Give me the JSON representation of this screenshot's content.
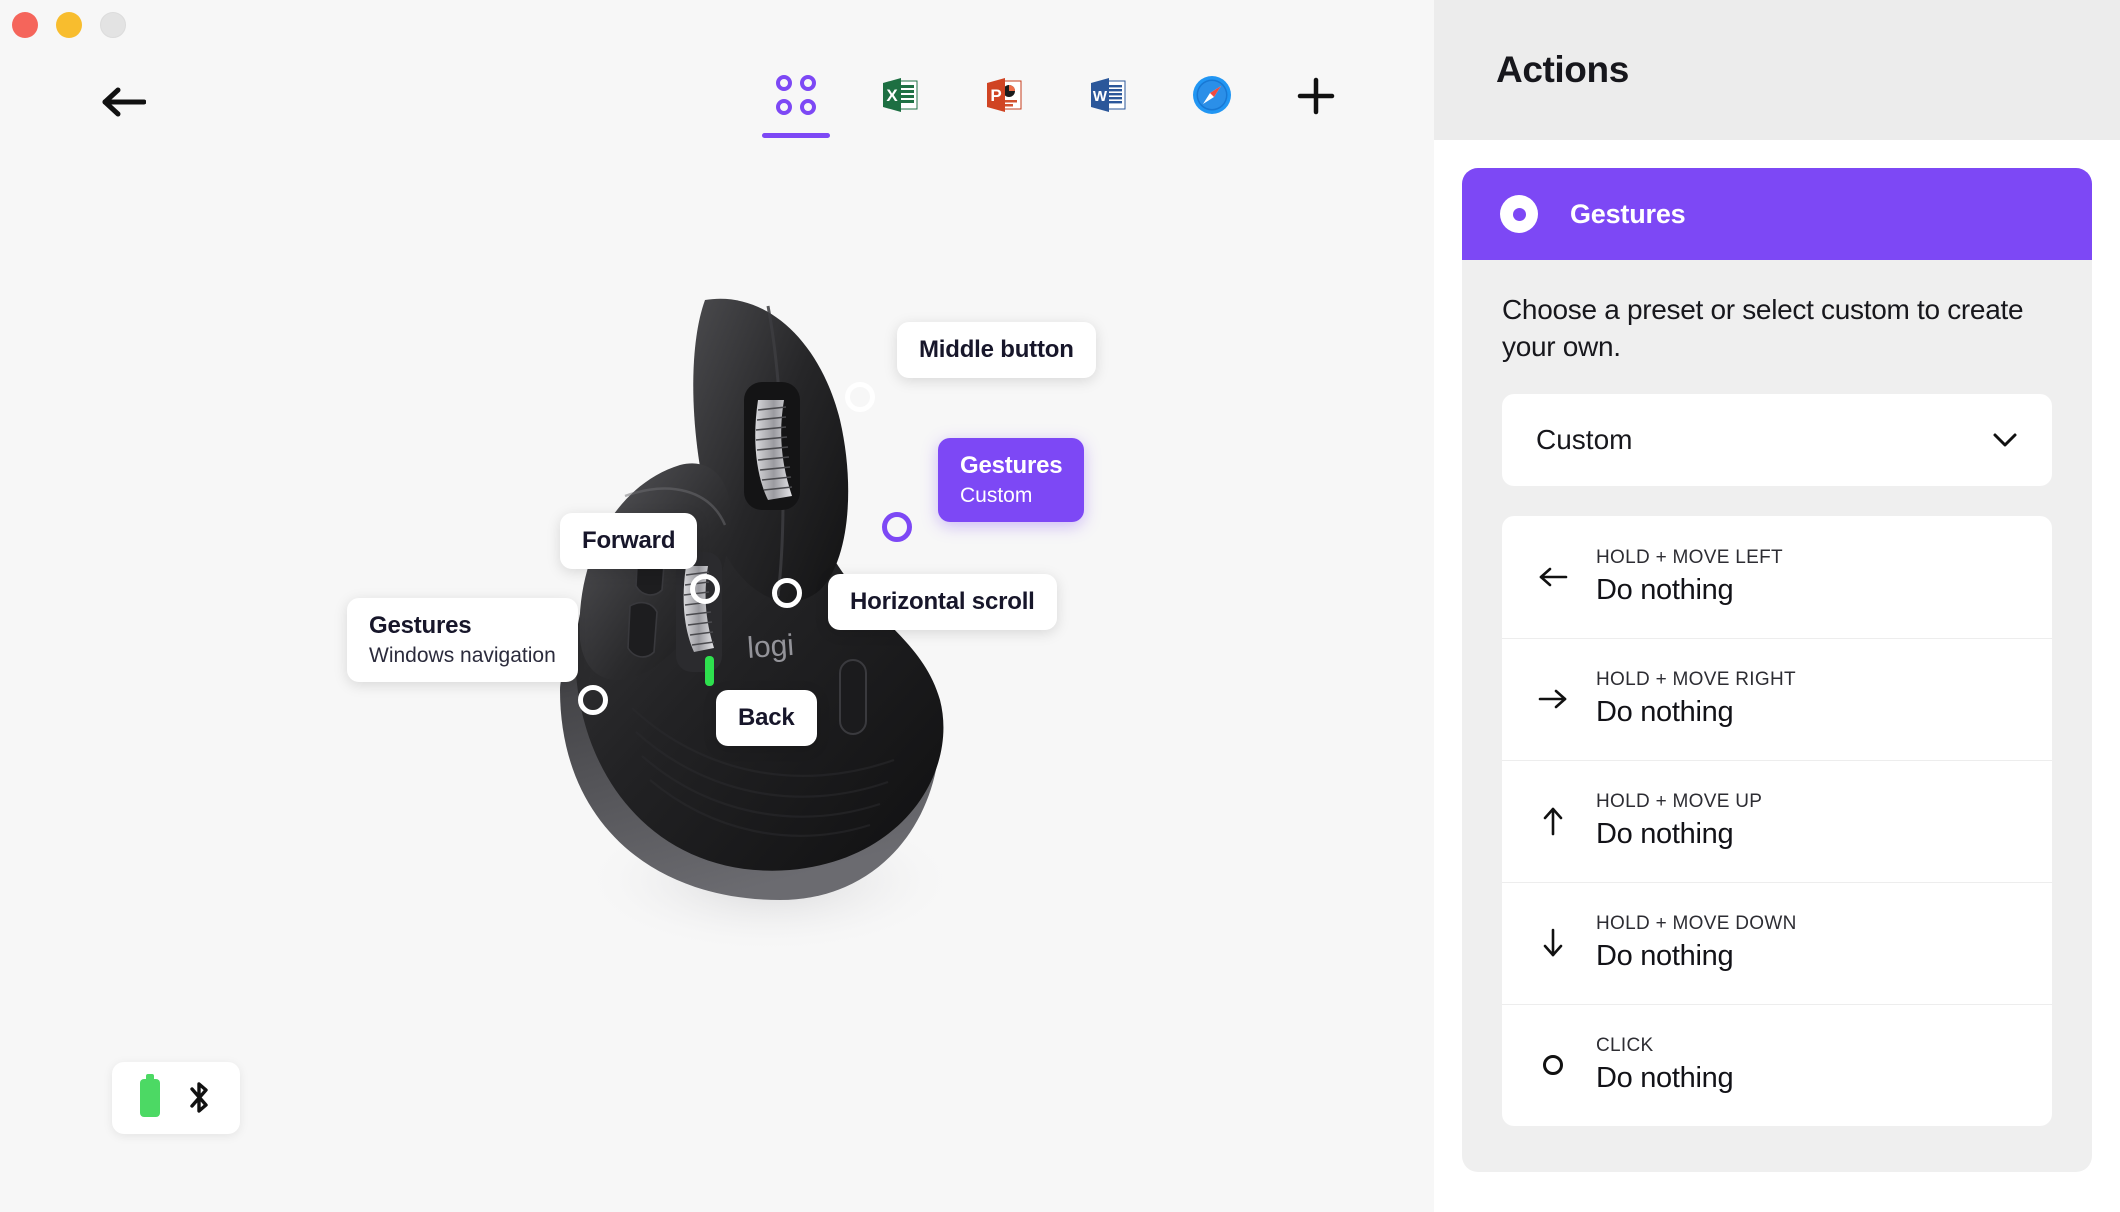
{
  "window": {
    "traffic_lights": [
      "close",
      "minimize",
      "maximize"
    ]
  },
  "toolbar": {
    "back_label": "Back",
    "add_label": "Add",
    "tabs": [
      {
        "id": "all-apps",
        "name": "all-apps-tab",
        "icon": "four-dots-icon",
        "active": true
      },
      {
        "id": "excel",
        "name": "excel-tab",
        "icon": "excel-icon",
        "active": false
      },
      {
        "id": "powerpoint",
        "name": "powerpoint-tab",
        "icon": "powerpoint-icon",
        "active": false
      },
      {
        "id": "word",
        "name": "word-tab",
        "icon": "word-icon",
        "active": false
      },
      {
        "id": "safari",
        "name": "safari-tab",
        "icon": "safari-icon",
        "active": false
      }
    ]
  },
  "device": {
    "brand": "logi",
    "status": {
      "battery_icon": "battery-icon",
      "bluetooth_icon": "bluetooth-icon"
    },
    "callouts": [
      {
        "title": "Middle button",
        "subtitle": "",
        "selected": false
      },
      {
        "title": "Gestures",
        "subtitle": "Custom",
        "selected": true
      },
      {
        "title": "Forward",
        "subtitle": "",
        "selected": false
      },
      {
        "title": "Horizontal scroll",
        "subtitle": "",
        "selected": false
      },
      {
        "title": "Gestures",
        "subtitle": "Windows navigation",
        "selected": false
      },
      {
        "title": "Back",
        "subtitle": "",
        "selected": false
      }
    ]
  },
  "panel": {
    "title": "Actions",
    "card": {
      "header_title": "Gestures",
      "helper_text": "Choose a preset or select custom to create your own.",
      "preset_select": {
        "value": "Custom",
        "options": [
          "Custom"
        ]
      },
      "actions": [
        {
          "icon": "arrow-left-icon",
          "label": "HOLD + MOVE LEFT",
          "value": "Do nothing"
        },
        {
          "icon": "arrow-right-icon",
          "label": "HOLD + MOVE RIGHT",
          "value": "Do nothing"
        },
        {
          "icon": "arrow-up-icon",
          "label": "HOLD + MOVE UP",
          "value": "Do nothing"
        },
        {
          "icon": "arrow-down-icon",
          "label": "HOLD + MOVE DOWN",
          "value": "Do nothing"
        },
        {
          "icon": "circle-icon",
          "label": "CLICK",
          "value": "Do nothing"
        }
      ]
    }
  },
  "colors": {
    "accent": "#7d48f5",
    "panel_header_bg": "#ececec",
    "card_bg": "#efefef",
    "battery_green": "#4cd964"
  }
}
